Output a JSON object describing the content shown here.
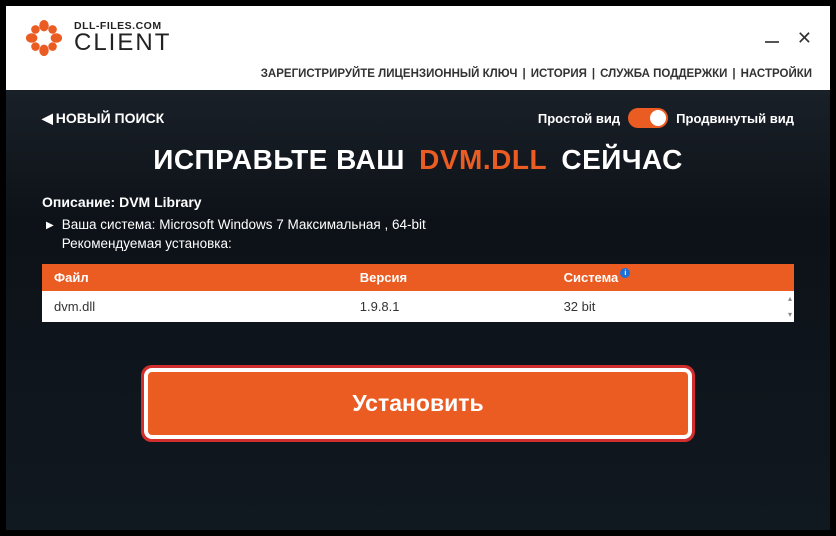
{
  "brand": {
    "top": "DLL-FILES.COM",
    "bottom": "CLIENT"
  },
  "nav": {
    "register": "ЗАРЕГИСТРИРУЙТЕ ЛИЦЕНЗИОННЫЙ КЛЮЧ",
    "history": "ИСТОРИЯ",
    "support": "СЛУЖБА ПОДДЕРЖКИ",
    "settings": "НАСТРОЙКИ"
  },
  "back": "НОВЫЙ ПОИСК",
  "view": {
    "simple": "Простой вид",
    "advanced": "Продвинутый вид"
  },
  "headline": {
    "before": "ИСПРАВЬТЕ ВАШ",
    "file": "DVM.DLL",
    "after": "СЕЙЧАС"
  },
  "desc_label": "Описание:",
  "desc_value": "DVM Library",
  "system_label": "Ваша система:",
  "system_value": "Microsoft Windows 7 Максимальная , 64-bit",
  "recommended": "Рекомендуемая установка:",
  "table": {
    "headers": {
      "file": "Файл",
      "version": "Версия",
      "system": "Система"
    },
    "row": {
      "file": "dvm.dll",
      "version": "1.9.8.1",
      "system": "32 bit"
    }
  },
  "install": "Установить"
}
